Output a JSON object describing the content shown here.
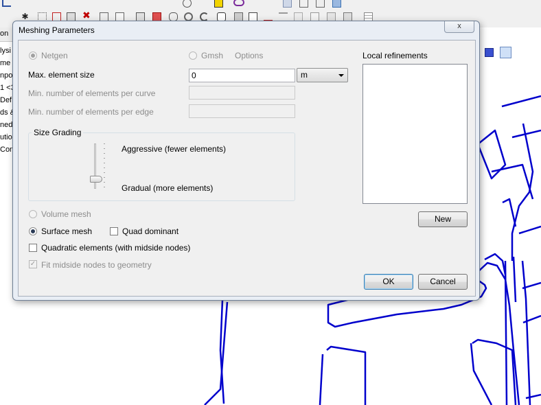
{
  "background_app": {
    "panel_header": "on",
    "tree_items": [
      "lysi",
      "me",
      "npo",
      "1 <3",
      "Def",
      "ds &",
      "ned",
      "utio",
      "Con"
    ]
  },
  "dialog": {
    "title": "Meshing Parameters",
    "close_label": "x",
    "mesher": {
      "netgen_label": "Netgen",
      "netgen_checked": true,
      "gmsh_label": "Gmsh",
      "options_label": "Options"
    },
    "max_element_size": {
      "label": "Max. element size",
      "value": "0",
      "unit": "m"
    },
    "min_per_curve": {
      "label": "Min. number of elements per curve",
      "value": ""
    },
    "min_per_edge": {
      "label": "Min. number of elements per edge",
      "value": ""
    },
    "size_grading": {
      "title": "Size Grading",
      "top_label": "Aggressive (fewer elements)",
      "bottom_label": "Gradual (more elements)",
      "level_fraction": 0.1
    },
    "volume_mesh": {
      "label": "Volume mesh",
      "checked": false
    },
    "surface_mesh": {
      "label": "Surface mesh",
      "checked": true
    },
    "quad_dominant": {
      "label": "Quad dominant",
      "checked": false
    },
    "quadratic_elements": {
      "label": "Quadratic elements (with midside nodes)",
      "checked": false
    },
    "fit_midside": {
      "label": "Fit midside nodes to geometry",
      "checked": true
    },
    "local_refinements": {
      "title": "Local refinements",
      "items": []
    },
    "new_button": "New",
    "ok_button": "OK",
    "cancel_button": "Cancel"
  },
  "colors": {
    "geometry_lines": "#0000cc",
    "dialog_frame": "#e9eef5"
  }
}
